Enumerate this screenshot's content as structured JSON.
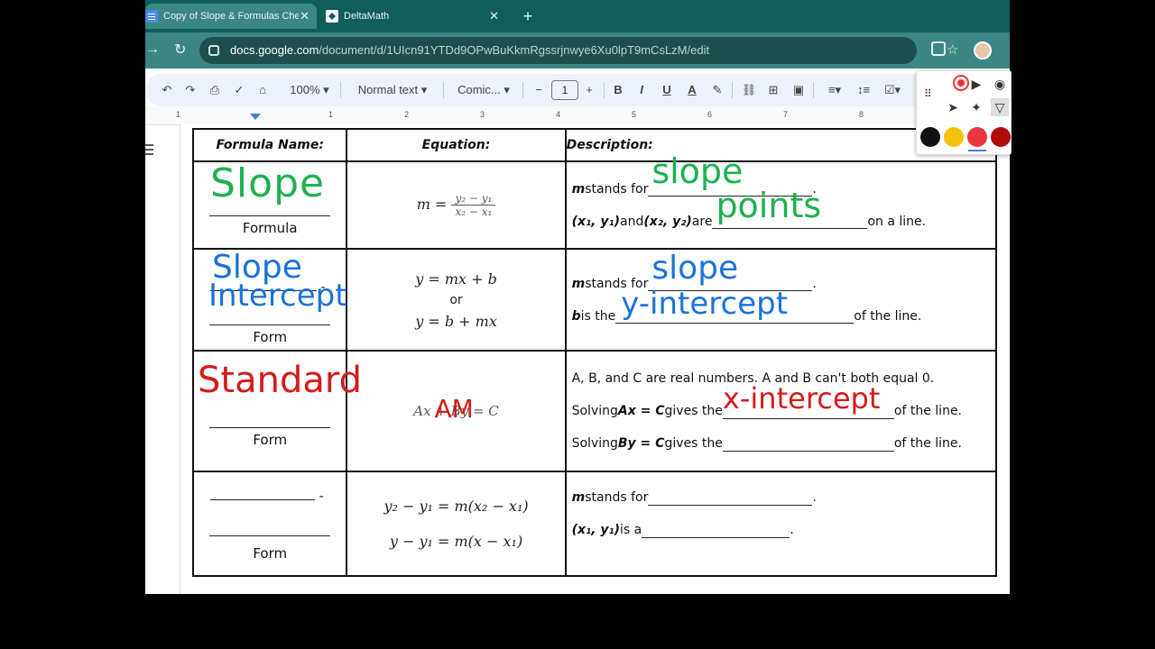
{
  "browser": {
    "tabs": [
      {
        "title": "Copy of Slope & Formulas Cheat Sheet",
        "active": true,
        "icon": "docs-icon"
      },
      {
        "title": "DeltaMath",
        "active": false,
        "icon": "deltamath-icon"
      }
    ],
    "url_host": "docs.google.com",
    "url_path": "/document/d/1UIcn91YTDd9OPwBuKkmRgssrjnwye6Xu0lpT9mCsLzM/edit"
  },
  "toolbar": {
    "zoom": "100%",
    "style": "Normal text",
    "font": "Comic...",
    "font_size": "1",
    "bold": "B",
    "italic": "I",
    "underline": "U",
    "text_color": "A"
  },
  "ruler": {
    "marks": [
      "1",
      "1",
      "2",
      "3",
      "4",
      "5",
      "6",
      "7",
      "8"
    ]
  },
  "table": {
    "headers": [
      "Formula Name:",
      "Equation:",
      "Description:"
    ],
    "rows": [
      {
        "form_word": "Formula",
        "handwriting": "Slope",
        "eq_lhs": "m =",
        "eq_num": "y₂ − y₁",
        "eq_den": "x₂ − x₁",
        "desc": [
          {
            "pre_b": "m",
            "pre": " stands for ",
            "fill": "slope",
            "post": "."
          },
          {
            "pre_b": "(x₁, y₁)",
            "mid": " and ",
            "mid_b": "(x₂, y₂)",
            "pre": " are ",
            "fill": "points",
            "post": " on a line."
          }
        ]
      },
      {
        "form_word": "Form",
        "handwriting_1": "Slope",
        "handwriting_2": "Intercept",
        "eq_1": "y = mx + b",
        "eq_or": "or",
        "eq_2": "y = b + mx",
        "desc": [
          {
            "pre_b": "m",
            "pre": " stands for ",
            "fill": "slope",
            "post": "."
          },
          {
            "pre_b": "b",
            "pre": " is the ",
            "fill": "y-intercept",
            "post": " of the line."
          }
        ]
      },
      {
        "form_word": "Form",
        "handwriting": "Standard",
        "eq": "Ax + By = C",
        "eq_scribble": "AM",
        "desc": [
          {
            "text": "A, B, and C are real numbers.  A and B can't both equal 0."
          },
          {
            "pre": "Solving  ",
            "pre_b": "Ax = C",
            "mid": " gives the ",
            "fill": "x-intercept",
            "post": " of the line."
          },
          {
            "pre": "Solving  ",
            "pre_b": "By = C",
            "mid": " gives the ",
            "fill": "",
            "post": " of the line."
          }
        ]
      },
      {
        "form_word": "Form",
        "dash": "-",
        "eq_1": "y₂ − y₁ = m(x₂ − x₁)",
        "eq_2": "y − y₁ = m(x − x₁)",
        "desc": [
          {
            "pre_b": "m",
            "pre": " stands for ",
            "fill": "",
            "post": "."
          },
          {
            "pre_b": "(x₁, y₁)",
            "pre": " is a ",
            "fill": "",
            "post": "."
          }
        ]
      }
    ]
  },
  "palette": {
    "colors": [
      "#111111",
      "#f4c20d",
      "#e8383d",
      "#b00b0b"
    ],
    "selected_color": "#e8383d"
  }
}
